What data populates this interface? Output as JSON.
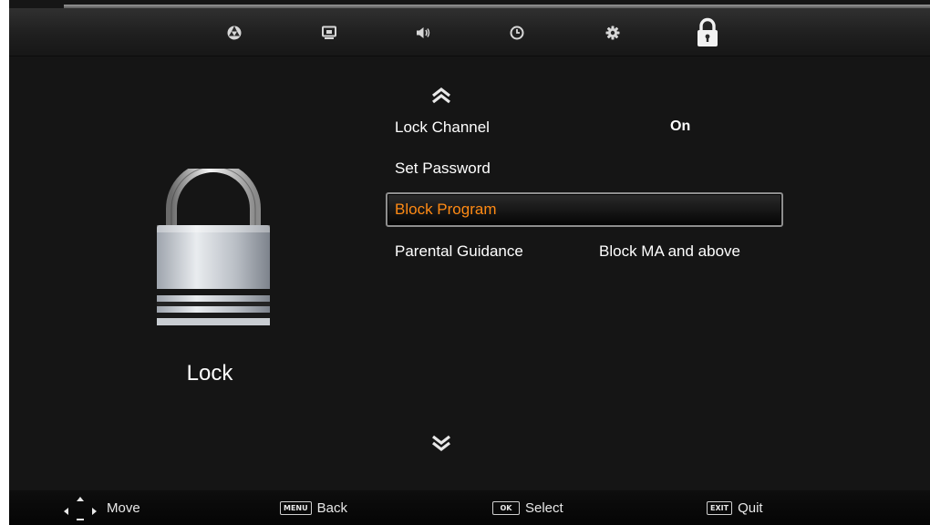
{
  "tabs": [
    {
      "icon": "picture-icon"
    },
    {
      "icon": "screen-icon"
    },
    {
      "icon": "sound-icon"
    },
    {
      "icon": "clock-icon"
    },
    {
      "icon": "gear-icon"
    },
    {
      "icon": "lock-icon",
      "active": true
    }
  ],
  "page": {
    "title": "Lock",
    "icon": "padlock-icon"
  },
  "menu": {
    "items": [
      {
        "label": "Lock Channel",
        "value": "On"
      },
      {
        "label": "Set Password",
        "value": ""
      },
      {
        "label": "Block Program",
        "value": "",
        "selected": true
      },
      {
        "label": "Parental Guidance",
        "value": "Block MA and above"
      }
    ],
    "scroll_up_icon": "double-chevron-up-icon",
    "scroll_down_icon": "double-chevron-down-icon"
  },
  "hints": {
    "move": {
      "label": "Move",
      "icon": "dpad-arrows-icon"
    },
    "back": {
      "label": "Back",
      "key": "MENU"
    },
    "select": {
      "label": "Select",
      "key": "OK"
    },
    "quit": {
      "label": "Quit",
      "key": "EXIT"
    }
  },
  "colors": {
    "selected_text": "#ff8a14",
    "background": "#151515",
    "text": "#ffffff"
  }
}
